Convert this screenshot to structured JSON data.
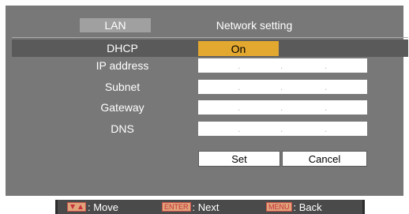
{
  "header": {
    "tab_label": "LAN",
    "title": "Network setting"
  },
  "rows": [
    {
      "label": "DHCP",
      "value": "On"
    },
    {
      "label": "IP address"
    },
    {
      "label": "Subnet"
    },
    {
      "label": "Gateway"
    },
    {
      "label": "DNS"
    }
  ],
  "ip_field": {
    "dot": "."
  },
  "buttons": {
    "set": "Set",
    "cancel": "Cancel"
  },
  "footer": {
    "move": ": Move",
    "enter_key": "ENTER",
    "next": ": Next",
    "menu_key": "MENU",
    "back": ": Back",
    "arrow_icon": "up-down-arrow-icon"
  },
  "colors": {
    "panel": "#787878",
    "selected_row": "#5a5a5a",
    "value_highlight": "#e3a830",
    "key_badge": "#e0a37a"
  }
}
